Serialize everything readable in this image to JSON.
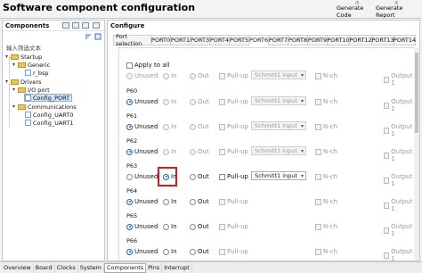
{
  "header": {
    "title": "Software component configuration",
    "generate_code": "Generate Code",
    "generate_report": "Generate Report"
  },
  "components": {
    "title": "Components",
    "filter_placeholder": "输入筛选文本",
    "tree": {
      "startup": "Startup",
      "generic": "Generic",
      "r_bsp": "r_bsp",
      "drivers": "Drivers",
      "io_port": "I/O port",
      "config_port": "Config_PORT",
      "communications": "Communications",
      "config_uart0": "Config_UART0",
      "config_uart1": "Config_UART1"
    }
  },
  "configure": {
    "title": "Configure",
    "tabs": [
      "Port selection",
      "PORT0",
      "PORT1",
      "PORT3",
      "PORT4",
      "PORT5",
      "PORT6",
      "PORT7",
      "PORT8",
      "PORT9",
      "PORT10",
      "PORT12",
      "PORT13",
      "PORT14"
    ],
    "active_tab": "PORT6",
    "apply_to_all": "Apply to all",
    "option_labels": {
      "unused": "Unused",
      "in": "In",
      "out": "Out",
      "pullup": "Pull-up",
      "schmitt": "Schmitt1 input",
      "nch": "N-ch",
      "output1": "Output 1"
    },
    "pins": [
      {
        "name": "P60",
        "selected": "Unused"
      },
      {
        "name": "P61",
        "selected": "Unused"
      },
      {
        "name": "P62",
        "selected": "Unused"
      },
      {
        "name": "P63",
        "selected": "In"
      },
      {
        "name": "P64",
        "selected": "Unused"
      },
      {
        "name": "P65",
        "selected": "Unused"
      },
      {
        "name": "P66",
        "selected": "Unused"
      }
    ]
  },
  "bottom_tabs": [
    "Overview",
    "Board",
    "Clocks",
    "System",
    "Components",
    "Pins",
    "Interrupt"
  ],
  "bottom_active": "Components",
  "colors": {
    "highlight": "#d21d1d",
    "selection": "#cde3f7",
    "radio_on": "#1c5fbf"
  }
}
